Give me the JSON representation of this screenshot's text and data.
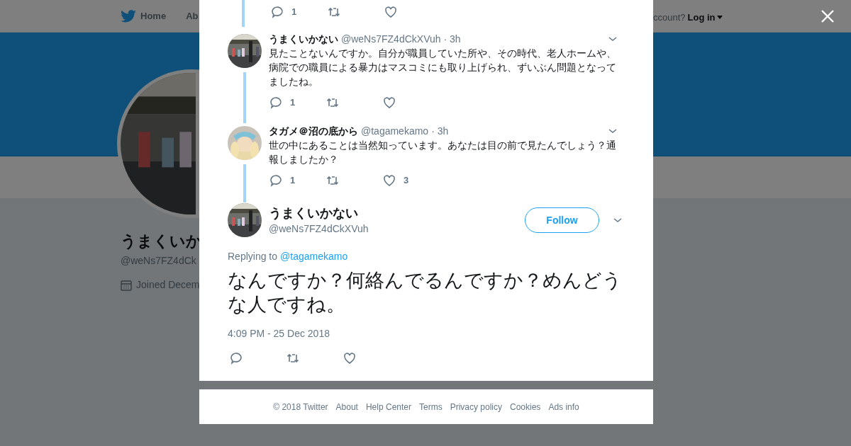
{
  "background": {
    "nav": {
      "items": [
        {
          "label": "Home"
        },
        {
          "label": "Ab"
        }
      ],
      "account_prompt": "ccount?",
      "login": "Log in"
    },
    "profile": {
      "name": "うまくいか",
      "handle": "@weNs7FZ4dCk",
      "joined": "Joined Decem"
    }
  },
  "thread": {
    "top_actions": {
      "replies": "1"
    },
    "tweets": [
      {
        "name": "うまくいかない",
        "handle": "@weNs7FZ4dCkXVuh",
        "time": "· 3h",
        "text": "見たことないんですか。自分が職員していた所や、その時代、老人ホームや、病院での職員による暴力はマスコミにも取り上げられ、ずいぶん問題となってましたね。",
        "actions": {
          "replies": "1"
        }
      },
      {
        "name": "タガメ＠沼の底から",
        "handle": "@tagamekamo",
        "time": "· 3h",
        "text": "世の中にあることは当然知っています。あなたは目の前で見たんでしょう？通報しましたか？",
        "actions": {
          "replies": "1",
          "likes": "3"
        }
      }
    ],
    "main": {
      "name": "うまくいかない",
      "handle": "@weNs7FZ4dCkXVuh",
      "follow": "Follow",
      "replying_label": "Replying to",
      "replying_to": "@tagamekamo",
      "text": "なんですか？何絡んでるんですか？めんどうな人ですね。",
      "timestamp": "4:09 PM - 25 Dec 2018"
    }
  },
  "footer": [
    "© 2018 Twitter",
    "About",
    "Help Center",
    "Terms",
    "Privacy policy",
    "Cookies",
    "Ads info"
  ]
}
